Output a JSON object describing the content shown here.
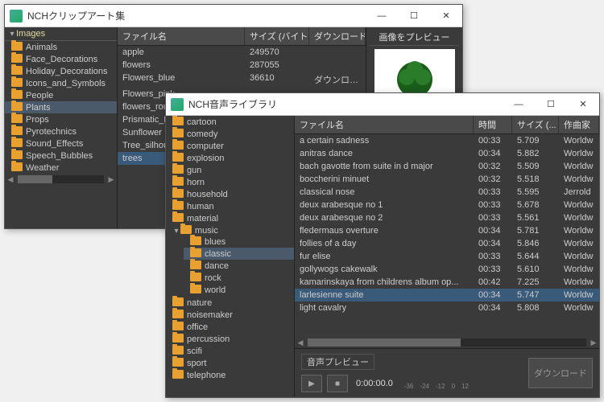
{
  "w1": {
    "title": "NCHクリップアート集",
    "tree_root": "Images",
    "folders": [
      "Animals",
      "Face_Decorations",
      "Holiday_Decorations",
      "Icons_and_Symbols",
      "People",
      "Plants",
      "Props",
      "Pyrotechnics",
      "Sound_Effects",
      "Speech_Bubbles",
      "Weather"
    ],
    "selected_folder": "Plants",
    "cols": {
      "name": "ファイル名",
      "size": "サイズ (バイト)",
      "dl": "ダウンロード..."
    },
    "files": [
      {
        "name": "apple",
        "size": "249570",
        "dl": ""
      },
      {
        "name": "flowers",
        "size": "287055",
        "dl": ""
      },
      {
        "name": "Flowers_blue",
        "size": "36610",
        "dl": "ダウンロード..."
      },
      {
        "name": "Flowers_pink",
        "size": "",
        "dl": ""
      },
      {
        "name": "flowers_round",
        "size": "",
        "dl": ""
      },
      {
        "name": "Prismatic_Lotu",
        "size": "",
        "dl": ""
      },
      {
        "name": "Sunflower",
        "size": "",
        "dl": ""
      },
      {
        "name": "Tree_silhouet",
        "size": "",
        "dl": ""
      },
      {
        "name": "trees",
        "size": "",
        "dl": ""
      }
    ],
    "selected_file": "trees",
    "preview_label": "画像をプレビュー"
  },
  "w2": {
    "title": "NCH音声ライブラリ",
    "folders_top": [
      "cartoon",
      "comedy",
      "computer",
      "explosion",
      "gun",
      "horn",
      "household",
      "human",
      "material"
    ],
    "music_label": "music",
    "music_sub": [
      "blues",
      "classic",
      "dance",
      "rock",
      "world"
    ],
    "selected_sub": "classic",
    "folders_bottom": [
      "nature",
      "noisemaker",
      "office",
      "percussion",
      "scifi",
      "sport",
      "telephone"
    ],
    "cols": {
      "name": "ファイル名",
      "time": "時間",
      "size": "サイズ (...",
      "comp": "作曲家"
    },
    "files": [
      {
        "name": "a certain sadness",
        "time": "00:33",
        "size": "5.709",
        "comp": "Worldw"
      },
      {
        "name": "anitras dance",
        "time": "00:34",
        "size": "5.882",
        "comp": "Worldw"
      },
      {
        "name": "bach gavotte from suite in d major",
        "time": "00:32",
        "size": "5.509",
        "comp": "Worldw"
      },
      {
        "name": "boccherini minuet",
        "time": "00:32",
        "size": "5.518",
        "comp": "Worldw"
      },
      {
        "name": "classical nose",
        "time": "00:33",
        "size": "5.595",
        "comp": "Jerrold"
      },
      {
        "name": "deux arabesque no 1",
        "time": "00:33",
        "size": "5.678",
        "comp": "Worldw"
      },
      {
        "name": "deux arabesque no 2",
        "time": "00:33",
        "size": "5.561",
        "comp": "Worldw"
      },
      {
        "name": "fledermaus overture",
        "time": "00:34",
        "size": "5.781",
        "comp": "Worldw"
      },
      {
        "name": "follies of a day",
        "time": "00:34",
        "size": "5.846",
        "comp": "Worldw"
      },
      {
        "name": "fur elise",
        "time": "00:33",
        "size": "5.644",
        "comp": "Worldw"
      },
      {
        "name": "gollywogs cakewalk",
        "time": "00:33",
        "size": "5.610",
        "comp": "Worldw"
      },
      {
        "name": "kamarinskaya from childrens album op...",
        "time": "00:42",
        "size": "7.225",
        "comp": "Worldw"
      },
      {
        "name": "larlesienne suite",
        "time": "00:34",
        "size": "5.747",
        "comp": "Worldw"
      },
      {
        "name": "light cavalry",
        "time": "00:34",
        "size": "5.808",
        "comp": "Worldw"
      }
    ],
    "selected_file": "larlesienne suite",
    "preview_label": "音声プレビュー",
    "play_time": "0:00:00.0",
    "meter_ticks": [
      "-36",
      "-24",
      "-12",
      "0",
      "12"
    ],
    "download_label": "ダウンロード"
  },
  "btns": {
    "min": "—",
    "max": "☐",
    "close": "✕"
  }
}
